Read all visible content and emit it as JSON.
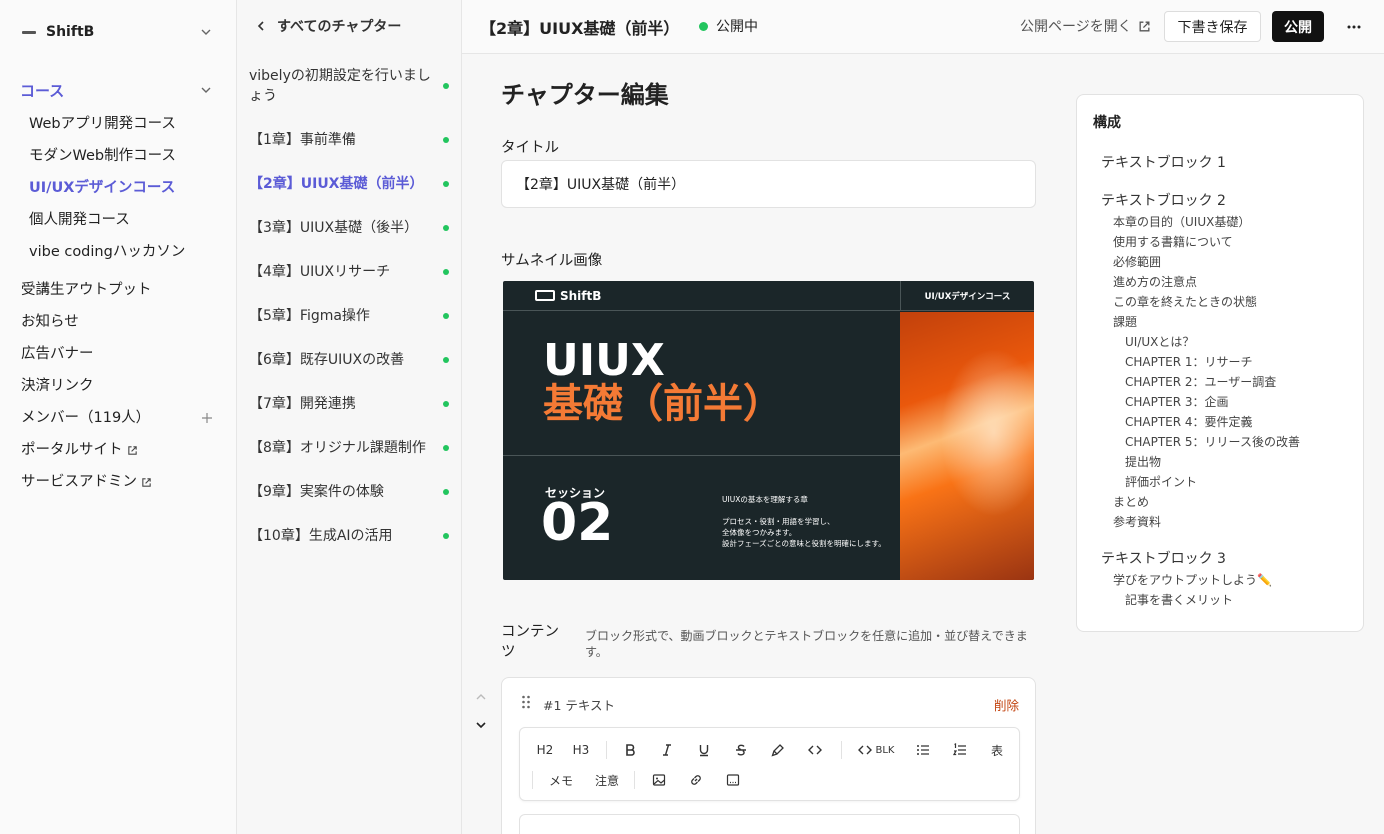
{
  "sidebar": {
    "brand": "ShiftB",
    "group_label": "コース",
    "courses": [
      "Webアプリ開発コース",
      "モダンWeb制作コース",
      "UI/UXデザインコース",
      "個人開発コース",
      "vibe codingハッカソン"
    ],
    "nav": {
      "outputs": "受講生アウトプット",
      "news": "お知らせ",
      "banner": "広告バナー",
      "payment": "決済リンク",
      "members": "メンバー（119人）",
      "portal": "ポータルサイト",
      "service_admin": "サービスアドミン"
    }
  },
  "chapters": {
    "back_label": "すべてのチャプター",
    "items": [
      "vibelyの初期設定を行いましょう",
      "【1章】事前準備",
      "【2章】UIUX基礎（前半）",
      "【3章】UIUX基礎（後半）",
      "【4章】UIUXリサーチ",
      "【5章】Figma操作",
      "【6章】既存UIUXの改善",
      "【7章】開発連携",
      "【8章】オリジナル課題制作",
      "【9章】実案件の体験",
      "【10章】生成AIの活用"
    ],
    "active_index": 2
  },
  "topbar": {
    "title": "【2章】UIUX基礎（前半）",
    "status": "公開中",
    "open_public": "公開ページを開く",
    "save_draft": "下書き保存",
    "publish": "公開"
  },
  "editor": {
    "heading": "チャプター編集",
    "title_label": "タイトル",
    "title_value": "【2章】UIUX基礎（前半）",
    "thumbnail_label": "サムネイル画像",
    "thumbnail": {
      "logo": "ShiftB",
      "course": "UI/UXデザインコース",
      "line1": "UIUX",
      "line2": "基礎（前半）",
      "session_label": "セッション",
      "session_num": "02",
      "desc1": "UIUXの基本を理解する章",
      "desc2": "プロセス・役割・用語を学習し、\n全体像をつかみます。\n設計フェーズごとの意味と役割を明確にします。"
    },
    "contents_label": "コンテンツ",
    "contents_hint": "ブロック形式で、動画ブロックとテキストブロックを任意に追加・並び替えできます。",
    "block": {
      "label": "#1 テキスト",
      "delete": "削除",
      "toolbar": {
        "h2": "H2",
        "h3": "H3",
        "blk": "BLK",
        "table": "表",
        "memo": "メモ",
        "caution": "注意"
      }
    }
  },
  "outline": {
    "title": "構成",
    "block1": "テキストブロック 1",
    "block2": "テキストブロック 2",
    "block2_items": [
      "本章の目的（UIUX基礎）",
      "使用する書籍について",
      "必修範囲",
      "進め方の注意点",
      "この章を終えたときの状態",
      "課題"
    ],
    "block2_sub": [
      "UI/UXとは？",
      "CHAPTER 1：リサーチ",
      "CHAPTER 2：ユーザー調査",
      "CHAPTER 3：企画",
      "CHAPTER 4：要件定義",
      "CHAPTER 5：リリース後の改善",
      "提出物",
      "評価ポイント"
    ],
    "block2_tail": [
      "まとめ",
      "参考資料"
    ],
    "block3": "テキストブロック 3",
    "block3_item": "学びをアウトプットしよう✏️",
    "block3_sub": "記事を書くメリット"
  },
  "colors": {
    "accent": "#5b5bd6",
    "published_dot": "#22c55e",
    "delete": "#c2410c",
    "thumbnail_orange": "#f47a35"
  }
}
